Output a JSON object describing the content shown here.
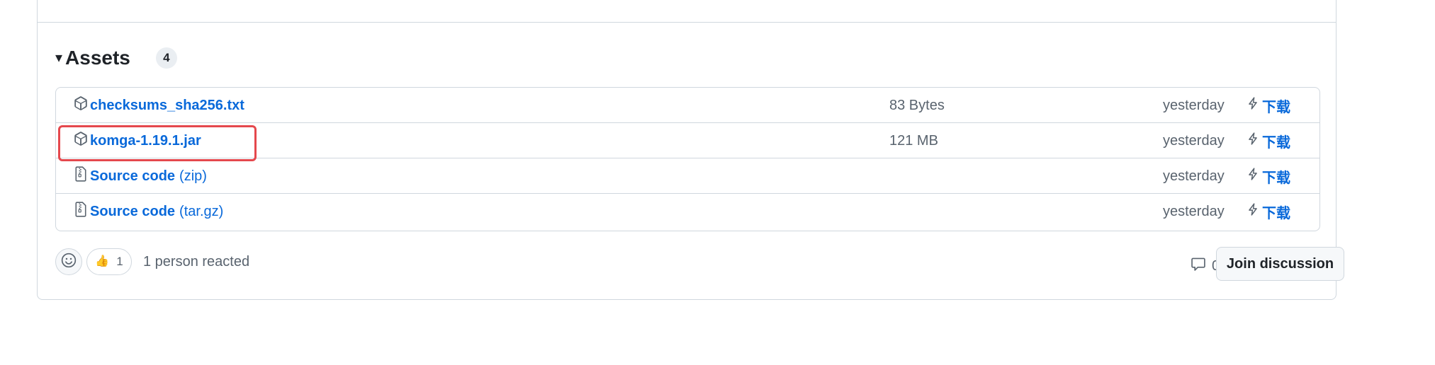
{
  "assets": {
    "title": "Assets",
    "count": "4",
    "items": [
      {
        "name": "checksums_sha256.txt",
        "suffix": "",
        "icon": "package-icon",
        "size": "83 Bytes",
        "date": "yesterday",
        "download_label": "下载"
      },
      {
        "name": "komga-1.19.1.jar",
        "suffix": "",
        "icon": "package-icon",
        "size": "121 MB",
        "date": "yesterday",
        "download_label": "下载"
      },
      {
        "name": "Source code",
        "suffix": "(zip)",
        "icon": "file-zip-icon",
        "size": "",
        "date": "yesterday",
        "download_label": "下载"
      },
      {
        "name": "Source code",
        "suffix": "(tar.gz)",
        "icon": "file-zip-icon",
        "size": "",
        "date": "yesterday",
        "download_label": "下载"
      }
    ]
  },
  "highlight_color": "#e5484d",
  "link_color": "#0969da",
  "reactions": {
    "thumb_count": "1",
    "summary": "1 person reacted"
  },
  "discussion": {
    "comment_count": "0",
    "join_label": "Join discussion"
  }
}
